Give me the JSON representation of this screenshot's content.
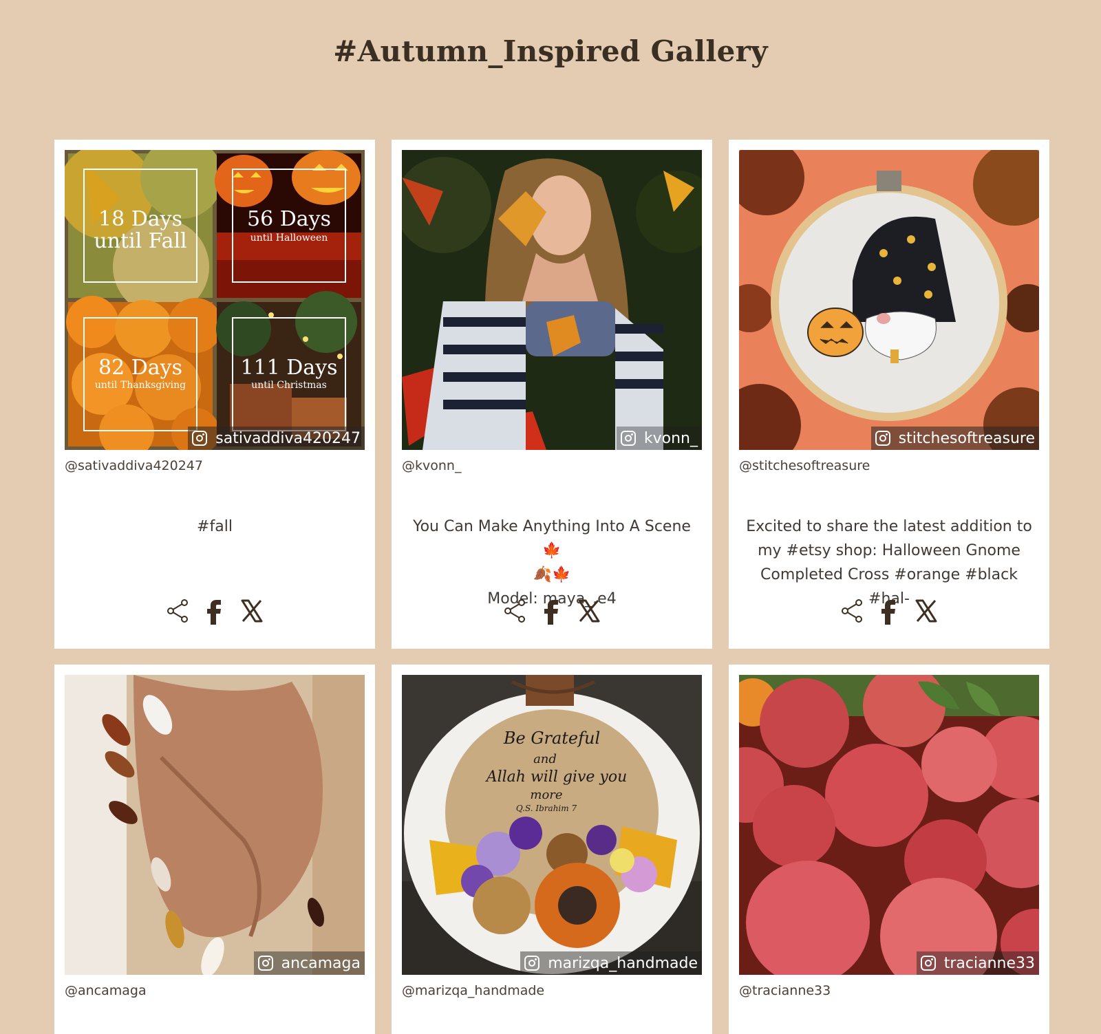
{
  "gallery": {
    "title": "#Autumn_Inspired Gallery"
  },
  "photo_texts": {
    "days_fall_number": "18 Days",
    "days_fall_label": "until Fall",
    "days_halloween_number": "56 Days",
    "days_halloween_label": "until Halloween",
    "days_thanksgiving_number": "82 Days",
    "days_thanksgiving_label": "until Thanksgiving",
    "days_christmas_number": "111 Days",
    "days_christmas_label": "until Christmas",
    "sign_line1": "Be Grateful",
    "sign_line2": "and",
    "sign_line3": "Allah will give you",
    "sign_line4": "more",
    "sign_line5": "Q.S. Ibrahim 7"
  },
  "posts": [
    {
      "username": "sativaddiva420247",
      "handle": "@sativaddiva420247",
      "caption": [
        "#fall"
      ]
    },
    {
      "username": "kvonn_",
      "handle": "@kvonn_",
      "caption": [
        "You Can Make Anything Into A Scene 🍁",
        "🍂🍁",
        "Model: maya_.e4"
      ]
    },
    {
      "username": "stitchesoftreasure",
      "handle": "@stitchesoftreasure",
      "caption": [
        "Excited to share the latest addition to",
        "my #etsy shop: Halloween Gnome",
        "Completed Cross #orange #black #hal-"
      ]
    },
    {
      "username": "ancamaga",
      "handle": "@ancamaga",
      "caption": []
    },
    {
      "username": "marizqa_handmade",
      "handle": "@marizqa_handmade",
      "caption": []
    },
    {
      "username": "tracianne33",
      "handle": "@tracianne33",
      "caption": []
    }
  ],
  "colors": {
    "page_background": "#e3ccb1",
    "card_background": "#ffffff",
    "icon_color": "#3d2f22"
  },
  "icons": [
    "instagram-icon",
    "share-icon",
    "facebook-icon",
    "x-icon"
  ]
}
